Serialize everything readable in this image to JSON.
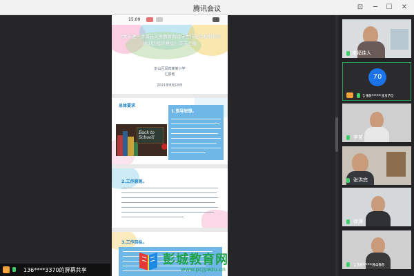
{
  "window": {
    "title": "腾讯会议"
  },
  "phone": {
    "time": "15:09",
    "slide1": {
      "title": "《关于进一步减轻义务教育阶段学生作业负担和校外培训负担的意见》交流汇报",
      "school": "彭山区凤鸣某某小学",
      "presenter": "汇报者",
      "date": "2021年8月10日"
    },
    "slide2": {
      "badge": "总体要求",
      "heading": "1.指导思想。",
      "board_text": "Back to School!"
    },
    "slide3": {
      "heading": "2.工作原则。"
    },
    "slide4": {
      "heading": "3.工作目标。"
    }
  },
  "participants": [
    {
      "name": "幸福佳人",
      "type": "video"
    },
    {
      "name": "136****3370",
      "type": "avatar",
      "avatar_text": "70"
    },
    {
      "name": "李苗",
      "type": "video"
    },
    {
      "name": "张洪宾",
      "type": "video"
    },
    {
      "name": "徐涛",
      "type": "video"
    },
    {
      "name": "158****8466",
      "type": "video"
    }
  ],
  "share_status": "136****3370的屏幕共享",
  "watermark": {
    "brand": "彭城教育网",
    "url": "www.pcjyedu.cn"
  },
  "colors": {
    "accent_green": "#2f9e4f",
    "avatar_blue": "#1a73e8",
    "slide_blue": "#6fb7e6"
  }
}
